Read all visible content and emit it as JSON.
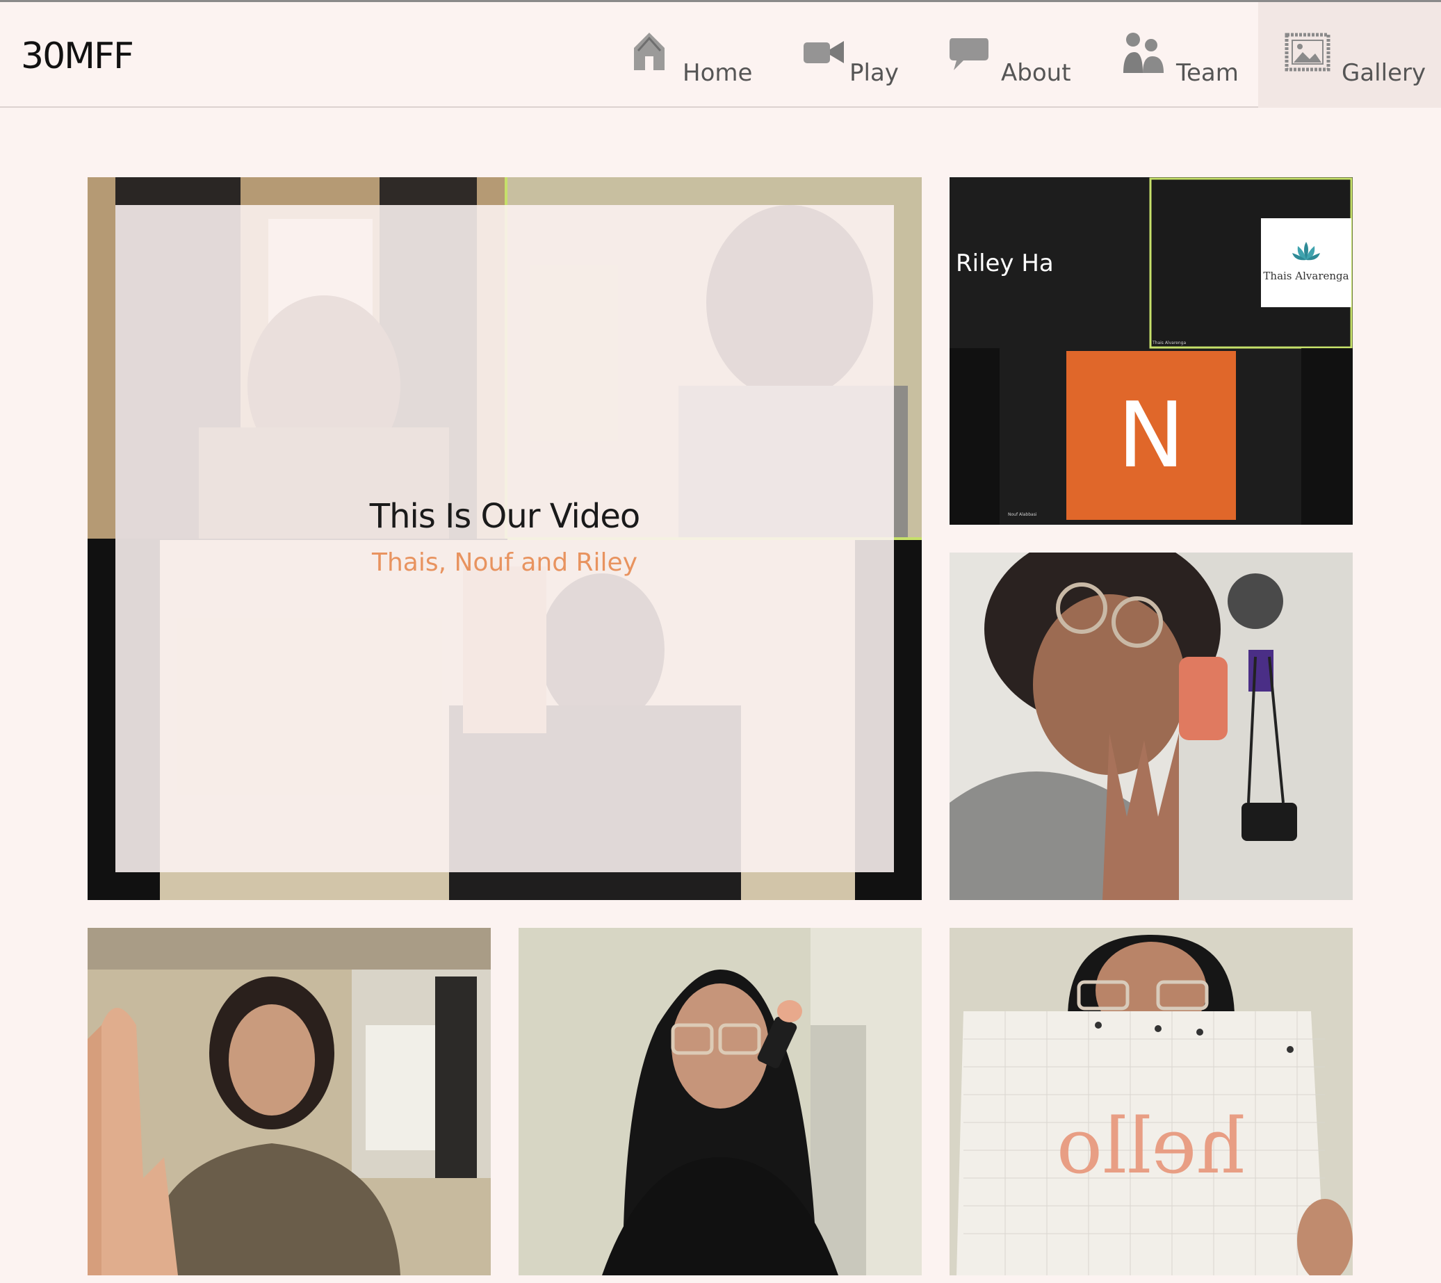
{
  "header": {
    "logo": "30MFF",
    "nav": [
      {
        "label": "Home",
        "icon": "home-icon"
      },
      {
        "label": "Play",
        "icon": "video-camera-icon"
      },
      {
        "label": "About",
        "icon": "speech-bubble-icon"
      },
      {
        "label": "Team",
        "icon": "people-icon"
      },
      {
        "label": "Gallery",
        "icon": "picture-frame-icon",
        "active": true
      }
    ]
  },
  "feature": {
    "title": "This Is Our Video",
    "subtitle": "Thais, Nouf and Riley"
  },
  "zoom_tile": {
    "participant_name": "Riley Ha",
    "profile_card_text": "Thais Alvarenga",
    "small_name_1": "Thais Alvarenga",
    "small_name_2": "Nouf Alabbasi",
    "avatar_letter": "N"
  },
  "hello_tile": {
    "sign_text": "hello"
  },
  "colors": {
    "background": "#fcf3f1",
    "accent": "#e8935f",
    "avatar_orange": "#e0672a",
    "zoom_dark": "#1d1d1d",
    "active_speaker_border": "#c6e06a"
  }
}
